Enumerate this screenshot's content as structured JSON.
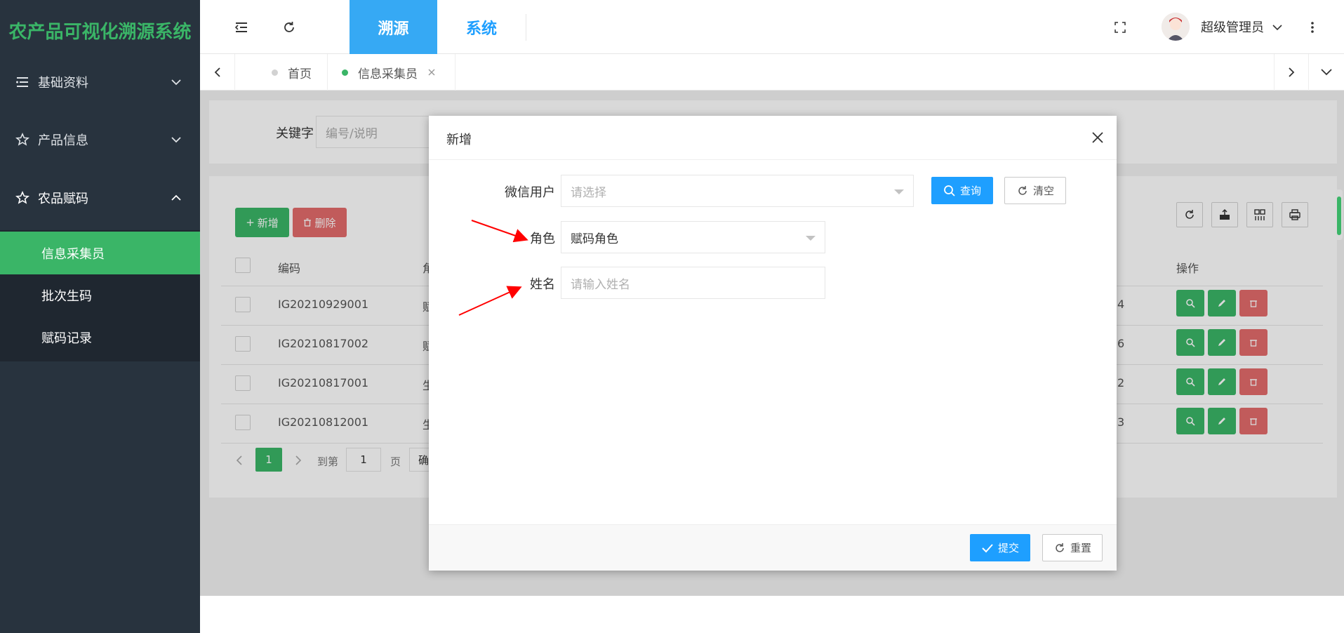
{
  "app": {
    "title": "农产品可视化溯源系统"
  },
  "sidebar": {
    "items": [
      {
        "label": "基础资料",
        "icon": "list-icon",
        "expanded": false
      },
      {
        "label": "产品信息",
        "icon": "star-icon",
        "expanded": false
      },
      {
        "label": "农品赋码",
        "icon": "star-icon",
        "expanded": true
      }
    ],
    "submenu": [
      {
        "label": "信息采集员",
        "active": true
      },
      {
        "label": "批次生码",
        "active": false
      },
      {
        "label": "赋码记录",
        "active": false
      }
    ]
  },
  "header": {
    "tabs": [
      {
        "label": "溯源",
        "active": true
      },
      {
        "label": "系统",
        "active": false
      }
    ],
    "user": {
      "name": "超级管理员"
    }
  },
  "page_tabs": [
    {
      "label": "首页",
      "active": false
    },
    {
      "label": "信息采集员",
      "active": true
    }
  ],
  "search": {
    "label": "关键字",
    "placeholder": "编号/说明"
  },
  "toolbar": {
    "add_label": "新增",
    "delete_label": "删除"
  },
  "table": {
    "columns": {
      "code": "编码",
      "role": "角",
      "op": "操作"
    },
    "rows": [
      {
        "code": "IG20210929001",
        "role": "赋",
        "tail": "4"
      },
      {
        "code": "IG20210817002",
        "role": "赋",
        "tail": "6"
      },
      {
        "code": "IG20210817001",
        "role": "生",
        "tail": "2"
      },
      {
        "code": "IG20210812001",
        "role": "生",
        "tail": "3"
      }
    ]
  },
  "pagination": {
    "current": "1",
    "goto_label": "到第",
    "goto_value": "1",
    "page_label": "页",
    "confirm_label": "确"
  },
  "modal": {
    "title": "新增",
    "fields": {
      "wechat_user": {
        "label": "微信用户",
        "placeholder": "请选择"
      },
      "role": {
        "label": "角色",
        "value": "赋码角色"
      },
      "name": {
        "label": "姓名",
        "placeholder": "请输入姓名"
      }
    },
    "query_label": "查询",
    "clear_label": "清空",
    "submit_label": "提交",
    "reset_label": "重置"
  },
  "colors": {
    "brand_green": "#3ab567",
    "blue": "#1e9fff",
    "danger": "#e36c6c",
    "sidebar_bg": "#28333e",
    "annotation_red": "#ff0000"
  }
}
